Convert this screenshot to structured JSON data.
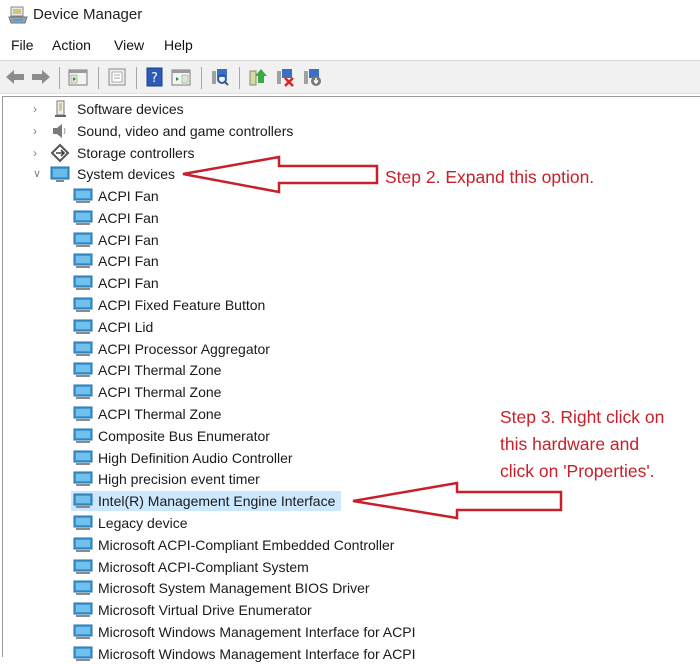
{
  "window": {
    "title": "Device Manager",
    "icon": "device-manager-icon"
  },
  "menubar": {
    "items": [
      "File",
      "Action",
      "View",
      "Help"
    ]
  },
  "toolbar": {
    "buttons": [
      {
        "name": "back-icon"
      },
      {
        "name": "forward-icon"
      },
      {
        "name": "show-hide-console-tree-icon"
      },
      {
        "name": "properties-icon"
      },
      {
        "name": "help-icon"
      },
      {
        "name": "show-hide-action-pane-icon"
      },
      {
        "name": "scan-hardware-changes-icon"
      },
      {
        "name": "update-driver-icon"
      },
      {
        "name": "uninstall-device-icon"
      },
      {
        "name": "disable-device-icon"
      }
    ]
  },
  "tree": {
    "categories": [
      {
        "label": "Software devices",
        "icon": "software-device-icon",
        "expanded": false
      },
      {
        "label": "Sound, video and game controllers",
        "icon": "speaker-icon",
        "expanded": false
      },
      {
        "label": "Storage controllers",
        "icon": "storage-controller-icon",
        "expanded": false
      },
      {
        "label": "System devices",
        "icon": "monitor-icon",
        "expanded": true
      }
    ],
    "system_devices": [
      "ACPI Fan",
      "ACPI Fan",
      "ACPI Fan",
      "ACPI Fan",
      "ACPI Fan",
      "ACPI Fixed Feature Button",
      "ACPI Lid",
      "ACPI Processor Aggregator",
      "ACPI Thermal Zone",
      "ACPI Thermal Zone",
      "ACPI Thermal Zone",
      "Composite Bus Enumerator",
      "High Definition Audio Controller",
      "High precision event timer",
      "Intel(R) Management Engine Interface",
      "Legacy device",
      "Microsoft ACPI-Compliant Embedded Controller",
      "Microsoft ACPI-Compliant System",
      "Microsoft System Management BIOS Driver",
      "Microsoft Virtual Drive Enumerator",
      "Microsoft Windows Management Interface for ACPI",
      "Microsoft Windows Management Interface for ACPI"
    ],
    "selected_device": "Intel(R) Management Engine Interface"
  },
  "annotations": {
    "step2": "Step 2. Expand this option.",
    "step3_lines": [
      "Step 3. Right click on",
      "this hardware and",
      "click on 'Properties'."
    ],
    "color": "#c8202a"
  }
}
